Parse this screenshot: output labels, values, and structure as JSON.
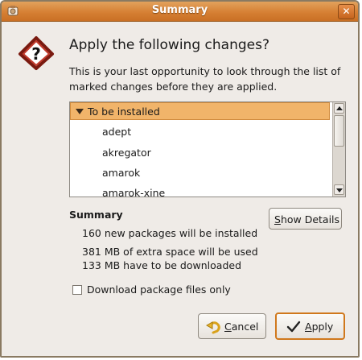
{
  "window": {
    "title": "Summary"
  },
  "dialog": {
    "heading": "Apply the following changes?",
    "description": "This is your last opportunity to look through the list of marked changes before they are applied."
  },
  "changes_list": {
    "group_label": "To be installed",
    "items": [
      "adept",
      "akregator",
      "amarok",
      "amarok-xine"
    ]
  },
  "summary": {
    "title": "Summary",
    "lines": [
      "160 new packages will be installed",
      "381 MB of extra space will be used",
      "133 MB have to be downloaded"
    ]
  },
  "buttons": {
    "show_details": {
      "mnemonic": "S",
      "rest": "how Details"
    },
    "cancel": {
      "mnemonic": "C",
      "rest": "ancel"
    },
    "apply": {
      "mnemonic": "A",
      "rest": "pply"
    }
  },
  "download_only": {
    "label": "Download package files only",
    "checked": false
  },
  "colors": {
    "titlebar": "#d68034",
    "selection": "#f1b46a",
    "focus_border": "#d0781c"
  },
  "icons": [
    "app-icon",
    "close-icon",
    "warning-question-icon",
    "expander-triangle-icon",
    "undo-arrow-icon",
    "checkmark-icon"
  ]
}
